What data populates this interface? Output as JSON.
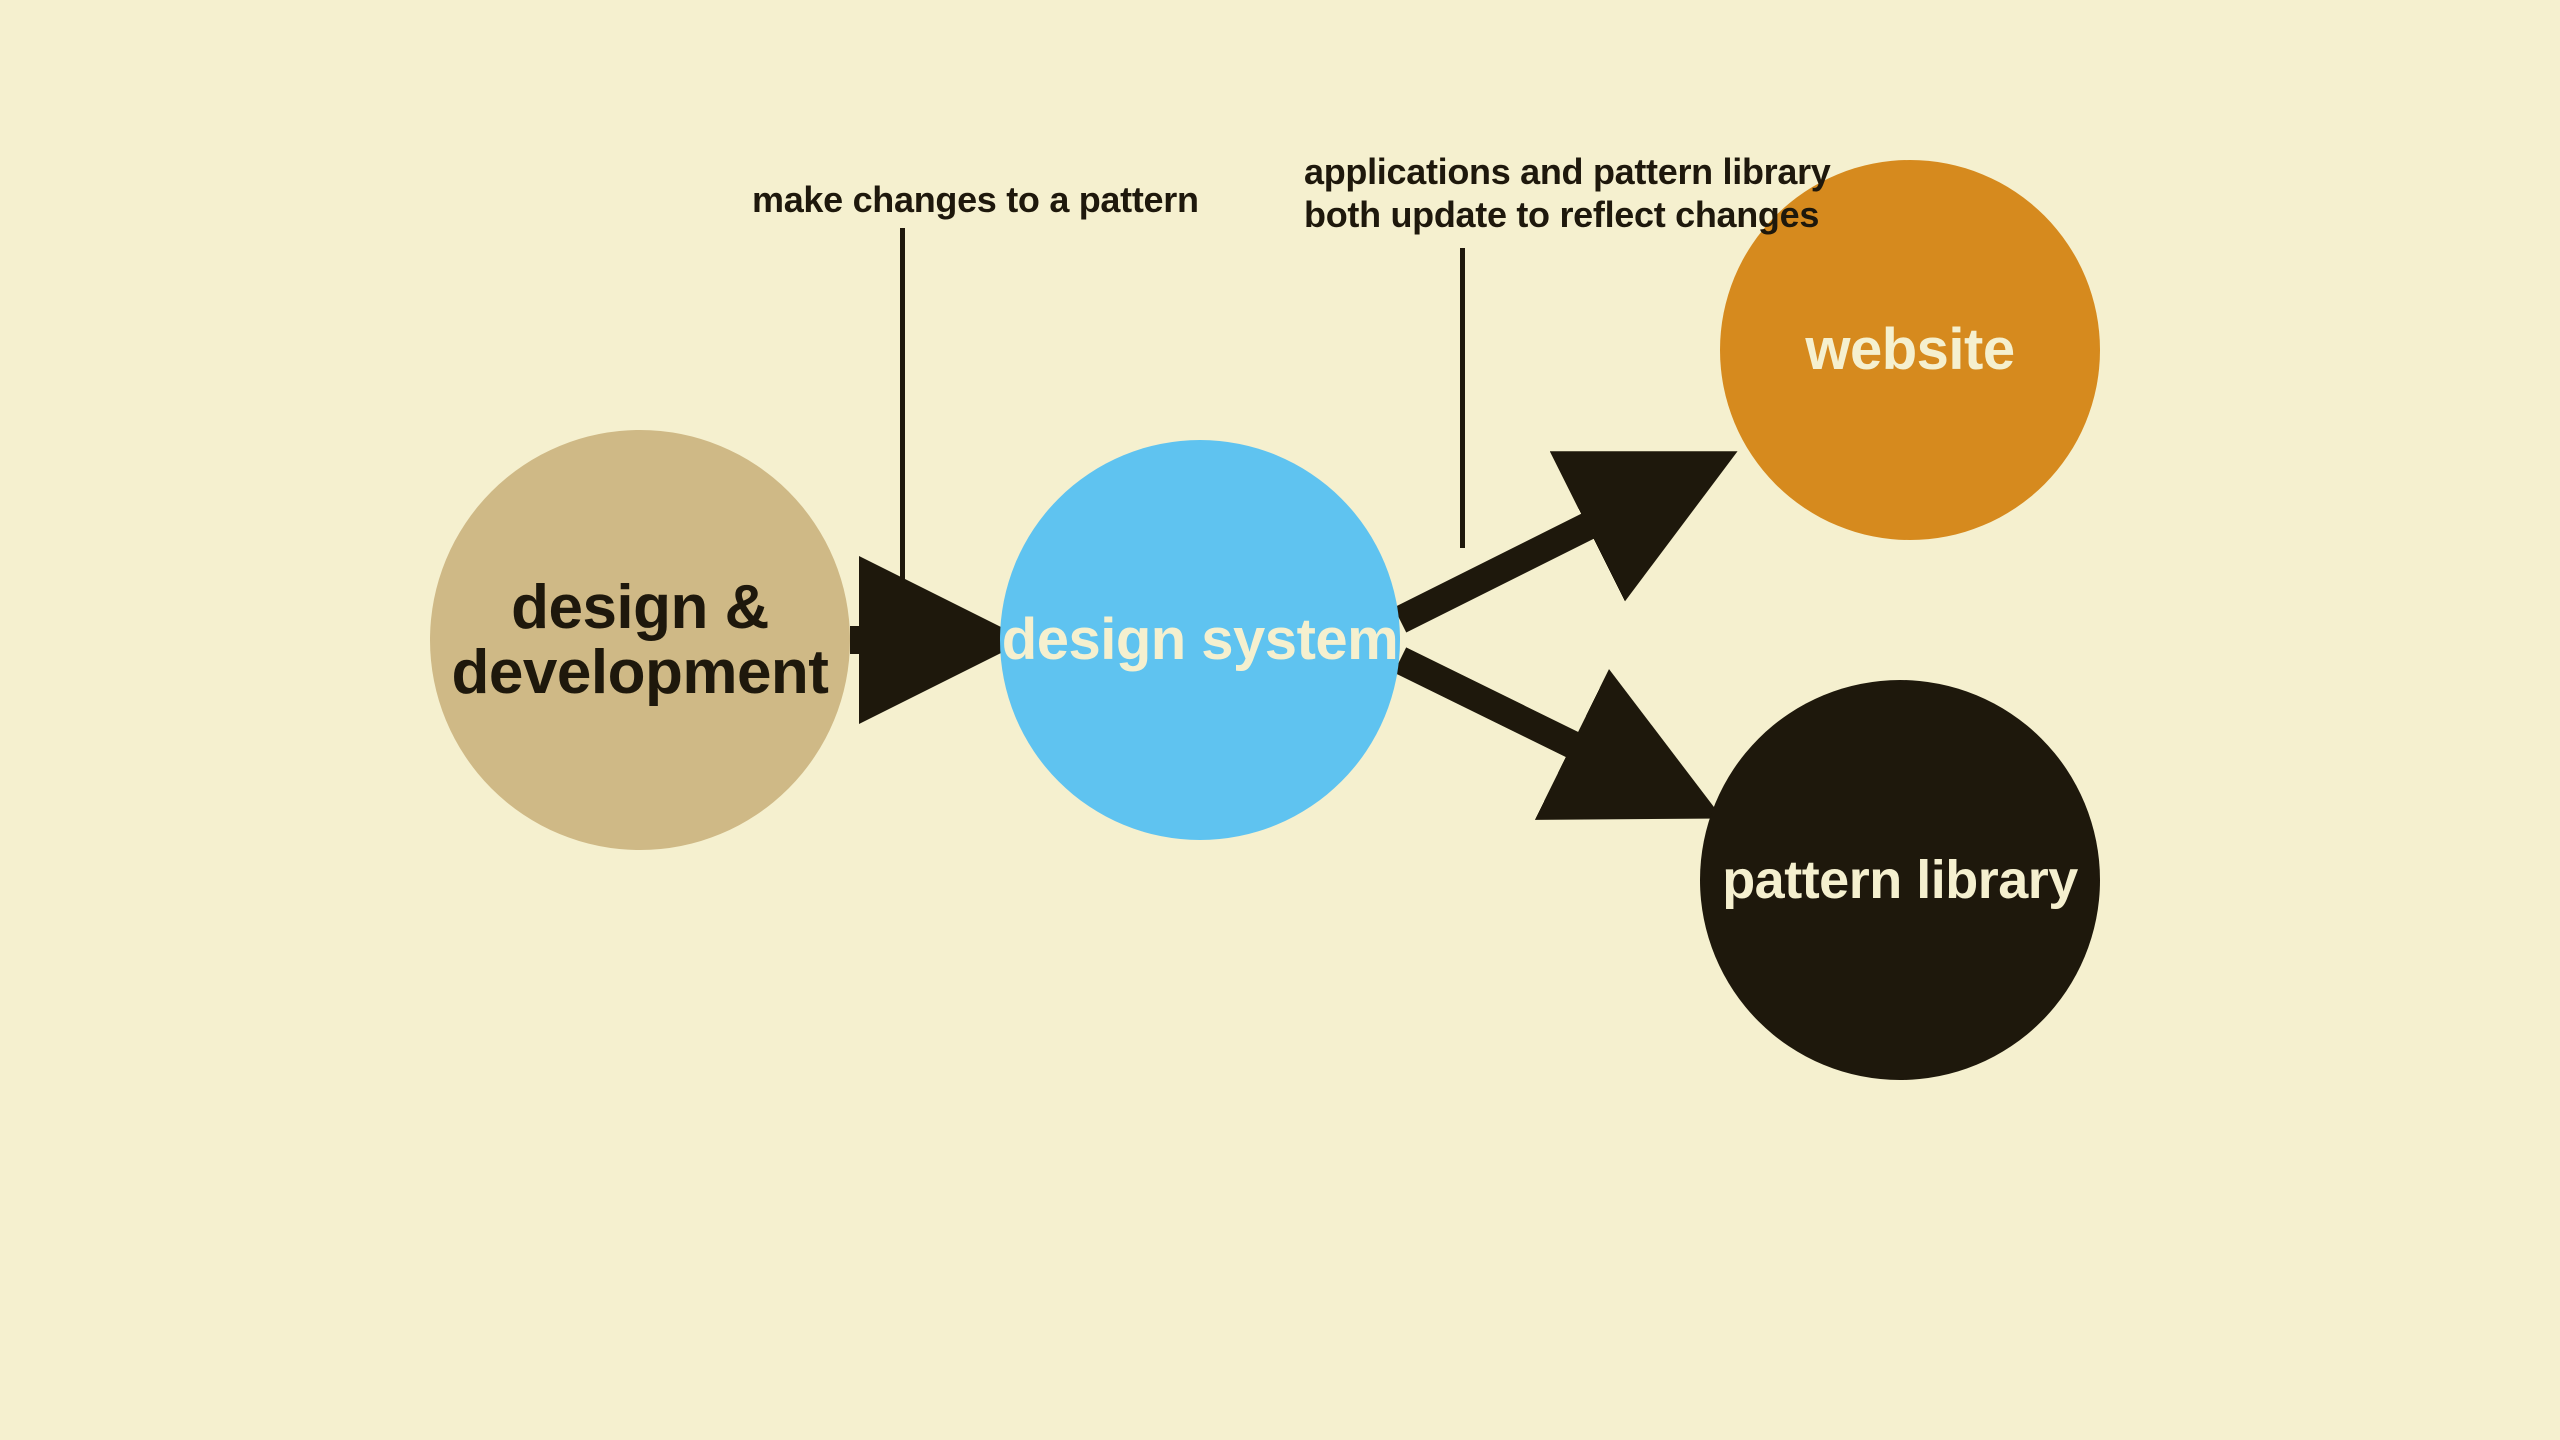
{
  "nodes": {
    "design_dev": "design & development",
    "design_system": "design system",
    "website": "website",
    "pattern_library": "pattern library"
  },
  "annotations": {
    "change_pattern": "make changes to a pattern",
    "update_both_line1": "applications and pattern library",
    "update_both_line2": "both update to reflect changes"
  },
  "colors": {
    "background": "#f5f0cf",
    "node_designdev": "#cfb986",
    "node_designsystem": "#5fc3f0",
    "node_website": "#d68a1e",
    "node_patternlib": "#1e180c",
    "text_dark": "#1e180c",
    "text_light": "#f5f0cf",
    "arrow": "#1e180c"
  }
}
